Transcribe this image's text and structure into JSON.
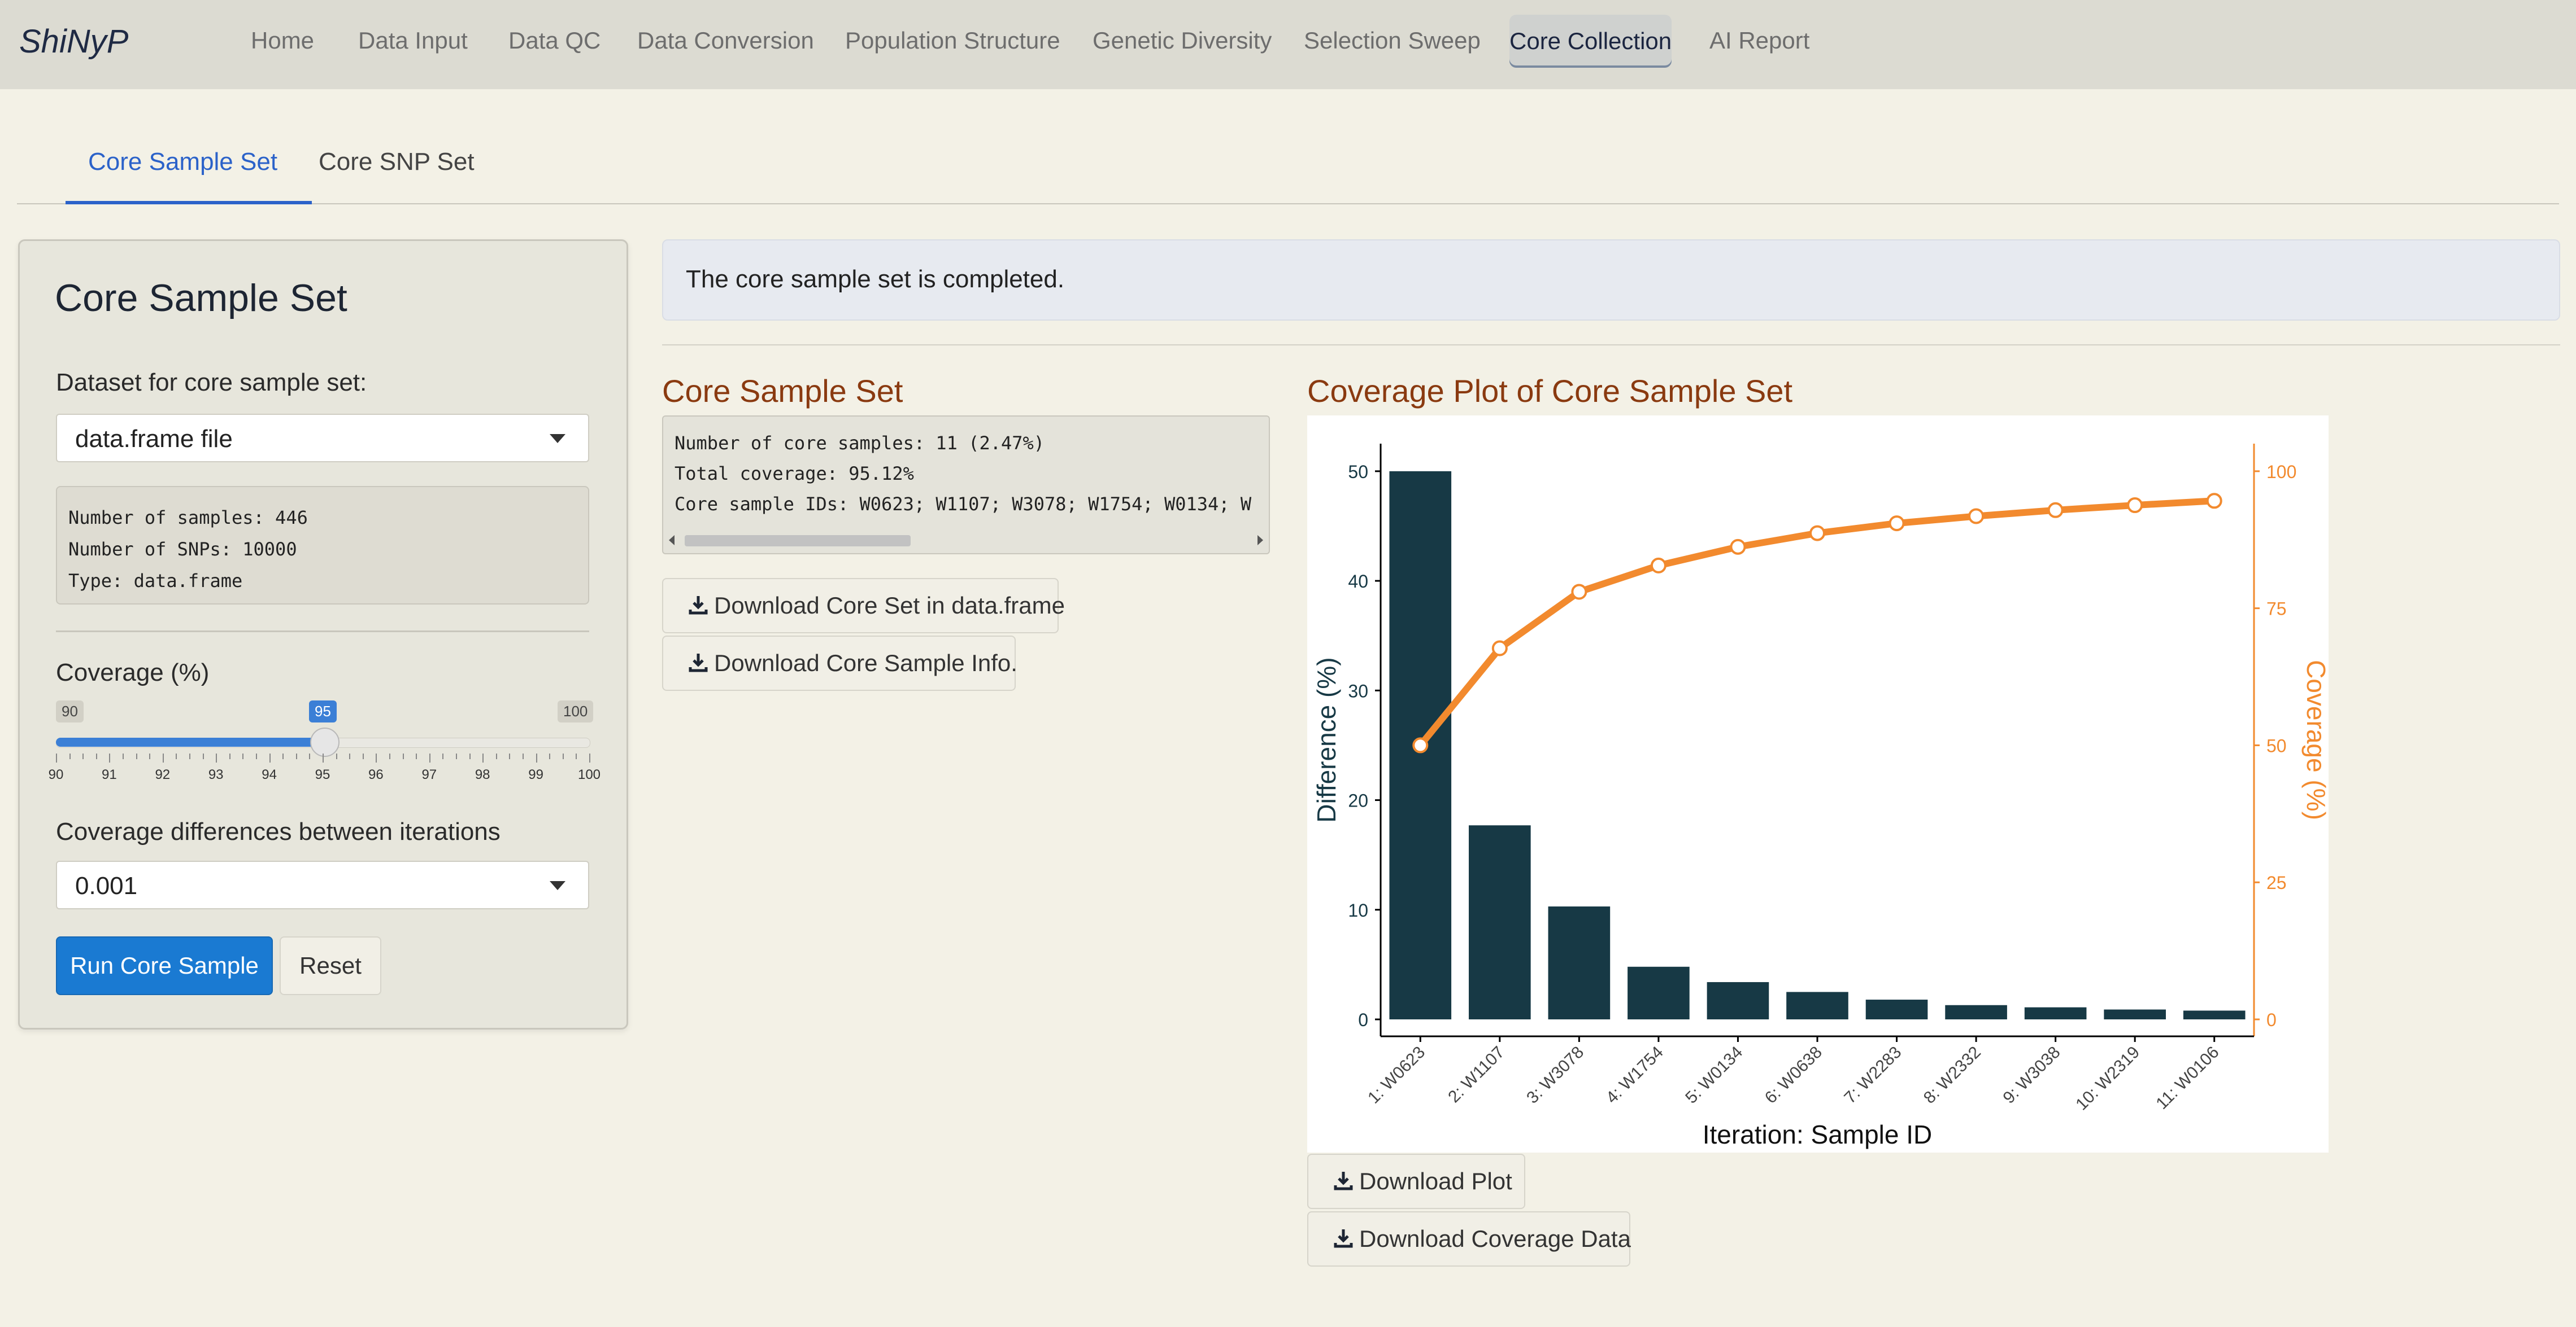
{
  "nav": {
    "brand": "ShiNyP",
    "items": [
      "Home",
      "Data Input",
      "Data QC",
      "Data Conversion",
      "Population Structure",
      "Genetic Diversity",
      "Selection Sweep",
      "Core Collection",
      "AI Report"
    ],
    "active": "Core Collection"
  },
  "subtabs": {
    "items": [
      "Core Sample Set",
      "Core SNP Set"
    ],
    "active": "Core Sample Set"
  },
  "panel": {
    "title": "Core Sample Set",
    "dataset_label": "Dataset for core sample set:",
    "dataset_value": "data.frame file",
    "info_lines": [
      "Number of samples: 446",
      "Number of SNPs: 10000",
      "Type: data.frame"
    ],
    "coverage_label": "Coverage (%)",
    "slider": {
      "min": "90",
      "max": "100",
      "value": "95",
      "ticks": [
        "90",
        "91",
        "92",
        "93",
        "94",
        "95",
        "96",
        "97",
        "98",
        "99",
        "100"
      ]
    },
    "diff_label": "Coverage differences between iterations",
    "diff_value": "0.001",
    "run_button": "Run Core Sample",
    "reset_button": "Reset"
  },
  "alert": "The core sample set is completed.",
  "core_set": {
    "title": "Core Sample Set",
    "lines": [
      "Number of core samples: 11 (2.47%)",
      "Total coverage: 95.12%",
      "Core sample IDs: W0623; W1107; W3078; W1754; W0134; W"
    ],
    "download_df": "Download Core Set in data.frame",
    "download_info": "Download Core Sample Info."
  },
  "plot": {
    "title": "Coverage Plot of Core Sample Set",
    "download_plot": "Download Plot",
    "download_coverage": "Download Coverage Data"
  },
  "colors": {
    "bar": "#173945",
    "line": "#f28a2e",
    "accent": "#2b62c9",
    "title": "#8a3a10"
  },
  "chart_data": {
    "type": "bar",
    "categories": [
      "1: W0623",
      "2: W1107",
      "3: W3078",
      "4: W1754",
      "5: W0134",
      "6: W0638",
      "7: W2283",
      "8: W2332",
      "9: W3038",
      "10: W2319",
      "11: W0106"
    ],
    "xlabel": "Iteration: Sample ID",
    "series": [
      {
        "name": "Difference (%)",
        "axis": "left",
        "type": "bar",
        "values": [
          50.0,
          17.7,
          10.3,
          4.8,
          3.4,
          2.5,
          1.8,
          1.3,
          1.1,
          0.9,
          0.8
        ]
      },
      {
        "name": "Coverage (%)",
        "axis": "right",
        "type": "line",
        "values": [
          50.0,
          67.7,
          78.0,
          82.8,
          86.2,
          88.7,
          90.5,
          91.8,
          92.9,
          93.8,
          94.6
        ]
      }
    ],
    "ylabel_left": "Difference (%)",
    "ylabel_right": "Coverage (%)",
    "ylim_left": [
      0,
      52
    ],
    "ylim_right": [
      0,
      104
    ],
    "yticks_left": [
      0,
      10,
      20,
      30,
      40,
      50
    ],
    "yticks_right": [
      0,
      25,
      50,
      75,
      100
    ],
    "grid": false
  }
}
